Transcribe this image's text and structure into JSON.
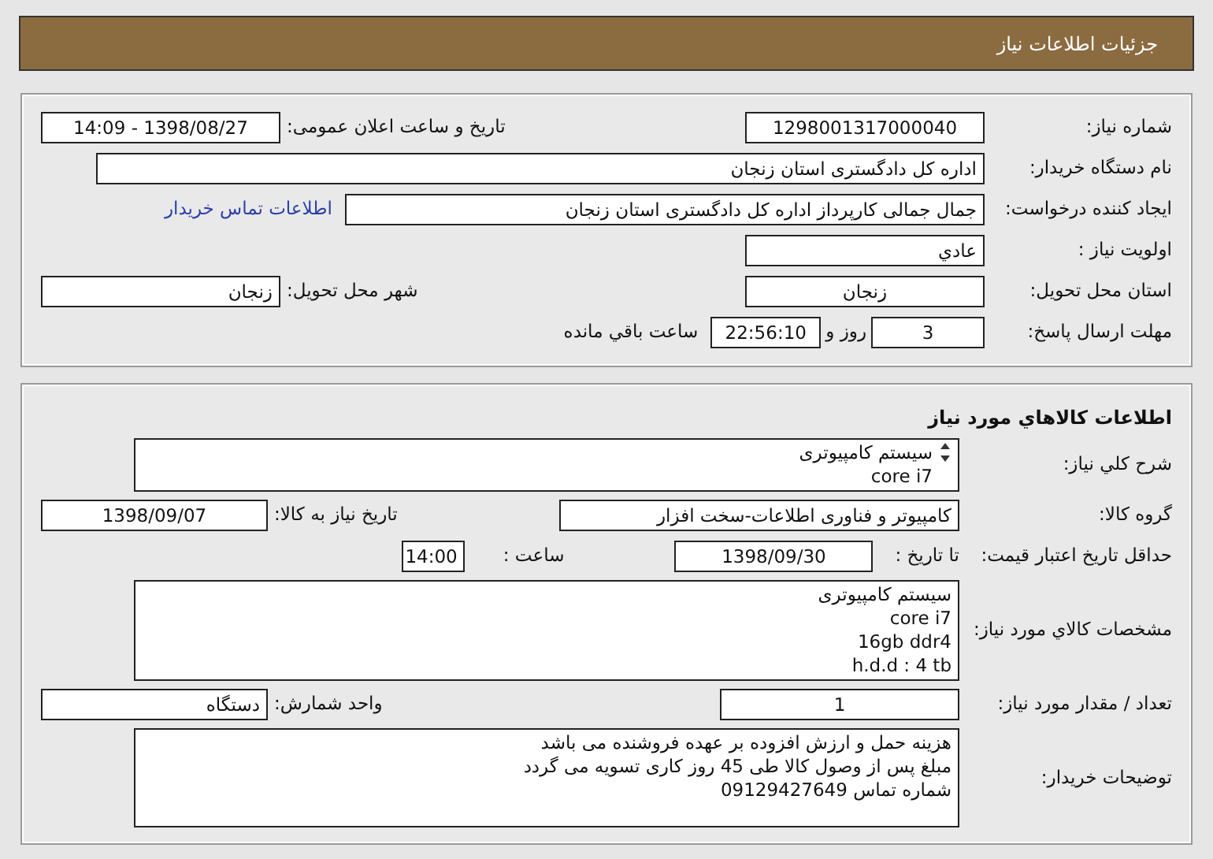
{
  "header": {
    "title": "جزئيات اطلاعات نياز"
  },
  "need_info": {
    "rows": [
      {
        "kind": "pair",
        "label": "شماره نياز:",
        "value": "1298001317000040",
        "label_2": "تاريخ و ساعت اعلان عمومی:",
        "value_2": "1398/08/27 - 14:09"
      },
      {
        "kind": "full",
        "label": "نام دستگاه خريدار:",
        "value": "اداره كل دادگستری استان زنجان"
      },
      {
        "kind": "wide",
        "label": "ايجاد كننده درخواست:",
        "value": "جمال جمالی كارپرداز اداره كل دادگستری استان زنجان",
        "link": "اطلاعات تماس خريدار"
      },
      {
        "kind": "single",
        "label": "اولويت نياز :",
        "value": "عادي"
      },
      {
        "kind": "pair",
        "label": "استان محل تحويل:",
        "value": "زنجان",
        "label_2": "شهر محل تحويل:",
        "value_2": "زنجان"
      },
      {
        "kind": "deadline",
        "label": "مهلت ارسال پاسخ:",
        "days": "3",
        "days_suffix": "روز و",
        "time": "22:56:10",
        "time_suffix": "ساعت باقي مانده"
      }
    ]
  },
  "goods_info": {
    "title": "اطلاعات كالاهاي مورد نياز",
    "rows": [
      {
        "kind": "area",
        "label": "شرح كلي نياز:",
        "lines": [
          "سيستم كامپيوتری",
          "core i7"
        ],
        "scrollable": true
      },
      {
        "kind": "pair_wide",
        "label": "گروه كالا:",
        "value": "كامپيوتر و فناوری اطلاعات-سخت افزار",
        "label_2": "تاريخ نياز به كالا:",
        "value_2": "1398/09/07"
      },
      {
        "kind": "validity",
        "label": "حداقل تاريخ اعتبار قيمت:",
        "date_label": "تا تاريخ :",
        "date": "1398/09/30",
        "time_label": "ساعت :",
        "time": "14:00"
      },
      {
        "kind": "area",
        "label": "مشخصات كالاي مورد نياز:",
        "lines": [
          "سيستم كامپيوتری",
          "core i7",
          "16gb ddr4",
          "h.d.d : 4 tb"
        ],
        "scrollable": false
      },
      {
        "kind": "pair",
        "label": "تعداد / مقدار مورد نياز:",
        "value": "1",
        "label_2": "واحد شمارش:",
        "value_2": "دستگاه"
      },
      {
        "kind": "area",
        "label": "توضيحات خريدار:",
        "lines": [
          "هزينه حمل و ارزش افزوده بر عهده فروشنده می باشد",
          "مبلغ پس از وصول كالا طی 45 روز كاری تسويه می گردد",
          "شماره تماس 09129427649"
        ],
        "scrollable": false
      }
    ]
  }
}
